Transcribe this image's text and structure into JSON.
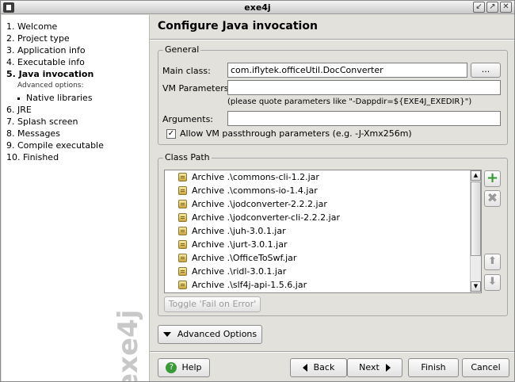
{
  "window": {
    "title": "exe4j",
    "minimize_icon": "minimize-icon",
    "maximize_icon": "maximize-icon",
    "close_icon": "close-icon"
  },
  "sidebar": {
    "steps": [
      "1. Welcome",
      "2. Project type",
      "3. Application info",
      "4. Executable info",
      "5. Java invocation",
      "Advanced options:",
      "Native libraries",
      "6. JRE",
      "7. Splash screen",
      "8. Messages",
      "9. Compile executable",
      "10. Finished"
    ],
    "active_index": 4,
    "watermark": "exe4j"
  },
  "page": {
    "title": "Configure Java invocation"
  },
  "general": {
    "label": "General",
    "main_class_label": "Main class:",
    "main_class_value": "com.iflytek.officeUtil.DocConverter",
    "browse_label": "...",
    "vm_params_label": "VM Parameters:",
    "vm_params_value": "",
    "vm_params_hint": "(please quote parameters like \"-Dappdir=${EXE4J_EXEDIR}\")",
    "arguments_label": "Arguments:",
    "arguments_value": "",
    "passthrough_label": "Allow VM passthrough parameters (e.g. -J-Xmx256m)",
    "passthrough_checked": true
  },
  "classpath": {
    "label": "Class Path",
    "items": [
      "Archive .\\commons-cli-1.2.jar",
      "Archive .\\commons-io-1.4.jar",
      "Archive .\\jodconverter-2.2.2.jar",
      "Archive .\\jodconverter-cli-2.2.2.jar",
      "Archive .\\juh-3.0.1.jar",
      "Archive .\\jurt-3.0.1.jar",
      "Archive .\\OfficeToSwf.jar",
      "Archive .\\ridl-3.0.1.jar",
      "Archive .\\slf4j-api-1.5.6.jar"
    ],
    "toggle_label": "Toggle 'Fail on Error'",
    "add_icon": "add-icon",
    "remove_icon": "remove-icon",
    "move_up_icon": "move-up-icon",
    "move_down_icon": "move-down-icon"
  },
  "advanced_options_label": "Advanced Options",
  "footer": {
    "help_label": "Help",
    "back_label": "Back",
    "next_label": "Next",
    "finish_label": "Finish",
    "cancel_label": "Cancel"
  },
  "colors": {
    "add_green": "#2e9a2e",
    "disabled_gray": "#9a9a9a",
    "help_green": "#3a9a3a"
  }
}
